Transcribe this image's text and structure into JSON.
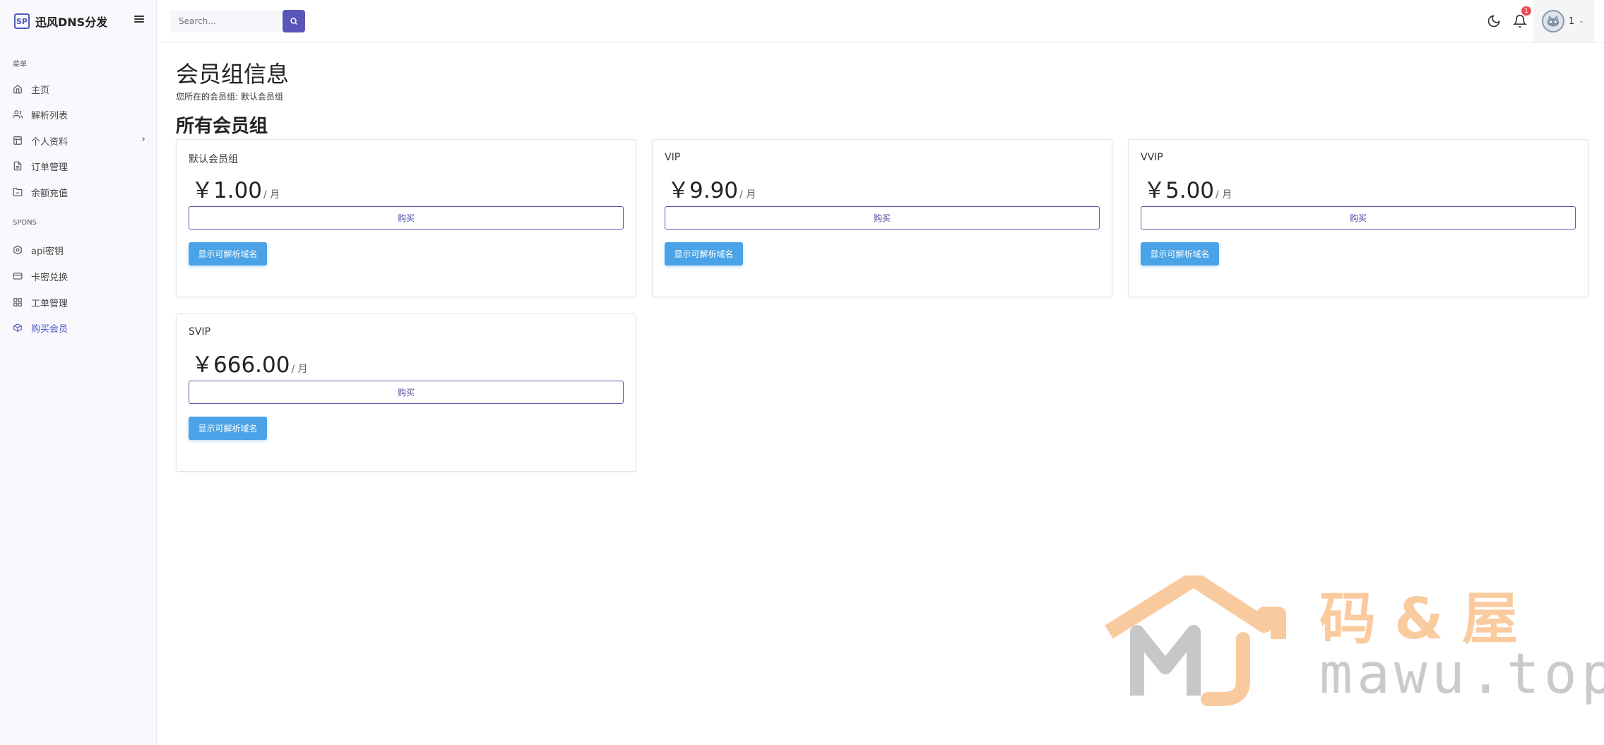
{
  "brand": {
    "logo_text": "SP",
    "name": "迅风DNS分发"
  },
  "sidebar": {
    "section_menu": "菜单",
    "section_spdns": "SPDNS",
    "items": [
      {
        "label": "主页",
        "icon": "home-icon"
      },
      {
        "label": "解析列表",
        "icon": "users-icon"
      },
      {
        "label": "个人资料",
        "icon": "table-icon"
      },
      {
        "label": "订单管理",
        "icon": "file-icon"
      },
      {
        "label": "余额充值",
        "icon": "folder-icon"
      },
      {
        "label": "api密钥",
        "icon": "hexagon-icon"
      },
      {
        "label": "卡密兑换",
        "icon": "credit-card-icon"
      },
      {
        "label": "工单管理",
        "icon": "grid-icon"
      },
      {
        "label": "购买会员",
        "icon": "package-icon"
      }
    ]
  },
  "header": {
    "search_placeholder": "Search...",
    "notification_count": "1",
    "username": "1"
  },
  "main": {
    "title": "会员组信息",
    "subtitle": "您所在的会员组: 默认会员组",
    "groups_heading": "所有会员组",
    "groups": [
      {
        "name": "默认会员组",
        "price": "￥1.00",
        "unit": "/ 月",
        "buy_label": "购买",
        "domains_label": "显示可解析域名"
      },
      {
        "name": "VIP",
        "price": "￥9.90",
        "unit": "/ 月",
        "buy_label": "购买",
        "domains_label": "显示可解析域名"
      },
      {
        "name": "VVIP",
        "price": "￥5.00",
        "unit": "/ 月",
        "buy_label": "购买",
        "domains_label": "显示可解析域名"
      },
      {
        "name": "SVIP",
        "price": "￥666.00",
        "unit": "/ 月",
        "buy_label": "购买",
        "domains_label": "显示可解析域名"
      }
    ]
  },
  "watermark": {
    "cn": "码&屋",
    "en": "mawu.top"
  },
  "colors": {
    "accent": "#5a55b8",
    "info_button": "#4aa3e6",
    "badge": "#e94f5a"
  }
}
